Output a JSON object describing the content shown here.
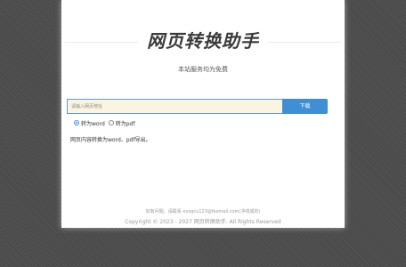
{
  "site": {
    "title": "网页转换助手",
    "subtitle": "本站服务均为免费"
  },
  "form": {
    "url_placeholder": "请输入网页地址",
    "download_label": "下载"
  },
  "options": [
    {
      "label": "转为word",
      "checked": true
    },
    {
      "label": "转为pdf",
      "checked": false
    }
  ],
  "description": "网页内容转换为word、pdf导出。",
  "footer": {
    "contact": "如有问题，请联系 xxxgcu123@foxmail.com(冲线成的)",
    "copyright": "Copyright © 2023 - 2027 网页转换助手. All Rights Reserved"
  },
  "colors": {
    "accent": "#3d8fd6",
    "input_bg": "#faf5e0",
    "page_bg": "#4a4a4a"
  }
}
